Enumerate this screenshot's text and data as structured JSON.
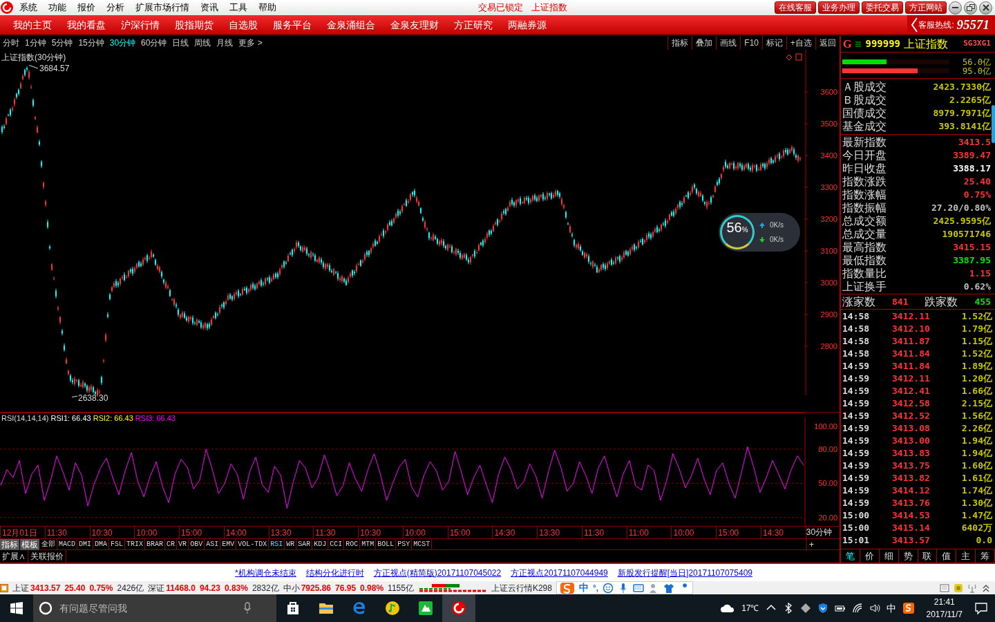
{
  "menu_bar": {
    "menus": [
      "系统",
      "功能",
      "报价",
      "分析",
      "扩展市场行情",
      "资讯",
      "工具",
      "帮助"
    ],
    "status": [
      "交易已锁定",
      "上证指数"
    ],
    "buttons": [
      "在线客服",
      "业务办理",
      "委托交易",
      "方正网站"
    ]
  },
  "nav": {
    "items": [
      "我的主页",
      "我的看盘",
      "沪深行情",
      "股指期货",
      "自选股",
      "服务平台",
      "金泉涌组合",
      "金泉友理财",
      "方正研究",
      "两融券源"
    ],
    "hotline_label": "客服热线:",
    "hotline": "95571"
  },
  "periods": [
    {
      "label": "分时",
      "selected": false
    },
    {
      "label": "1分钟",
      "selected": false
    },
    {
      "label": "5分钟",
      "selected": false
    },
    {
      "label": "15分钟",
      "selected": false
    },
    {
      "label": "30分钟",
      "selected": true
    },
    {
      "label": "60分钟",
      "selected": false
    },
    {
      "label": "日线",
      "selected": false
    },
    {
      "label": "周线",
      "selected": false
    },
    {
      "label": "月线",
      "selected": false
    },
    {
      "label": "更多 >",
      "selected": false
    }
  ],
  "chart_tools": [
    "指标",
    "叠加",
    "画线",
    "F10",
    "标记",
    "+自选",
    "返回"
  ],
  "price_chart": {
    "title": "上证指数(30分钟)",
    "high_label": "3684.57",
    "low_label": "2638.30",
    "axis_labels": [
      "3600",
      "3500",
      "3400",
      "3300",
      "3200",
      "3100",
      "3000",
      "2900",
      "2800"
    ]
  },
  "rsi": {
    "title": "RSI(14,14,14)",
    "lines": [
      {
        "label": "RSI1: 66.43",
        "color": "#ffffff"
      },
      {
        "label": "RSI2: 66.43",
        "color": "#ffff00"
      },
      {
        "label": "RSI3: 66.43",
        "color": "#ff00ff"
      }
    ],
    "chart_data": {
      "type": "line",
      "grid": true,
      "ylim": [
        12,
        112
      ],
      "yticks": [
        {
          "value": 100,
          "label": "100.00"
        },
        {
          "value": 80,
          "label": "80.00"
        },
        {
          "value": 50,
          "label": "50.00"
        },
        {
          "value": 20,
          "label": "20.00"
        }
      ],
      "series": [
        {
          "color": "#ff00ff",
          "values": [
            48,
            62,
            55,
            70,
            41,
            58,
            66,
            35,
            52,
            74,
            60,
            44,
            68,
            57,
            30,
            49,
            63,
            72,
            55,
            40,
            61,
            77,
            52,
            38,
            56,
            69,
            47,
            33,
            58,
            71,
            64,
            45,
            53,
            80,
            62,
            41,
            50,
            67,
            58,
            36,
            60,
            73,
            49,
            42,
            65,
            57,
            28,
            51,
            70,
            63,
            46,
            55,
            75,
            59,
            39,
            48,
            68,
            54,
            43,
            62,
            76,
            58,
            35,
            50,
            64,
            71,
            47,
            38,
            57,
            69,
            61,
            44,
            52,
            78,
            60,
            40,
            55,
            66,
            49,
            33,
            58,
            73,
            62,
            45,
            51,
            67,
            56,
            37,
            60,
            79,
            64,
            43,
            50,
            69,
            57,
            41,
            63,
            74,
            55,
            38,
            58,
            70,
            48,
            44,
            66,
            61,
            35,
            52,
            76,
            63,
            46,
            57,
            72,
            54,
            40,
            61,
            68,
            50,
            37,
            59,
            82,
            64,
            42,
            55,
            70,
            58,
            45,
            62,
            74,
            66
          ]
        }
      ]
    }
  },
  "time_axis": {
    "labels": [
      "12月01日",
      "11:30",
      "10:30",
      "10:00",
      "15:00",
      "14:00",
      "13:30",
      "11:30",
      "10:30",
      "10:00",
      "15:00",
      "14:30",
      "13:30",
      "11:30",
      "11:00",
      "10:00",
      "15:00",
      "14:30"
    ],
    "period": "30分钟",
    "plus": "+"
  },
  "indicator_menu": [
    "指标",
    "模板"
  ],
  "indicators": [
    {
      "label": "全部",
      "selected": false
    },
    {
      "label": "MACD",
      "selected": false
    },
    {
      "label": "DMI",
      "selected": false
    },
    {
      "label": "DMA",
      "selected": false
    },
    {
      "label": "FSL",
      "selected": false
    },
    {
      "label": "TRIX",
      "selected": false
    },
    {
      "label": "BRAR",
      "selected": false
    },
    {
      "label": "CR",
      "selected": false
    },
    {
      "label": "VR",
      "selected": false
    },
    {
      "label": "OBV",
      "selected": false
    },
    {
      "label": "ASI",
      "selected": false
    },
    {
      "label": "EMV",
      "selected": false
    },
    {
      "label": "VOL-TDX",
      "selected": false
    },
    {
      "label": "RSI",
      "selected": true
    },
    {
      "label": "WR",
      "selected": false
    },
    {
      "label": "SAR",
      "selected": false
    },
    {
      "label": "KDJ",
      "selected": false
    },
    {
      "label": "CCI",
      "selected": false
    },
    {
      "label": "ROC",
      "selected": false
    },
    {
      "label": "MTM",
      "selected": false
    },
    {
      "label": "BOLL",
      "selected": false
    },
    {
      "label": "PSY",
      "selected": false
    },
    {
      "label": "MCST",
      "selected": false
    }
  ],
  "ext_tabs": [
    "扩展∧",
    "关联报价"
  ],
  "quote": {
    "prefix": "G",
    "code": "999999",
    "name": "上证指数",
    "tag": "SG3XG1"
  },
  "flow_bars": [
    {
      "reading": "56.0亿",
      "level": 0.41,
      "color": "#00dd00"
    },
    {
      "reading": "95.0亿",
      "level": 0.7,
      "color": "#ff3333"
    }
  ],
  "turnover": [
    {
      "label": "Ａ股成交",
      "value": "2423.7330亿"
    },
    {
      "label": "Ｂ股成交",
      "value": "2.2265亿"
    },
    {
      "label": "国债成交",
      "value": "8979.7971亿"
    },
    {
      "label": "基金成交",
      "value": "393.8141亿"
    }
  ],
  "stats": [
    {
      "label": "最新指数",
      "value": "3413.5",
      "color": "#ff3232"
    },
    {
      "label": "今日开盘",
      "value": "3389.47",
      "color": "#ff3232"
    },
    {
      "label": "昨日收盘",
      "value": "3388.17",
      "color": "#ffffff"
    },
    {
      "label": "指数涨跌",
      "value": "25.40",
      "color": "#ff3232"
    },
    {
      "label": "指数涨幅",
      "value": "0.75%",
      "color": "#ff3232"
    },
    {
      "label": "指数振幅",
      "value": "27.20/0.80%",
      "color": "#c0c0c0"
    },
    {
      "label": "总成交额",
      "value": "2425.9595亿",
      "color": "#c8c800"
    },
    {
      "label": "总成交量",
      "value": "190571746",
      "color": "#c8c800"
    },
    {
      "label": "最高指数",
      "value": "3415.15",
      "color": "#ff3232"
    },
    {
      "label": "最低指数",
      "value": "3387.95",
      "color": "#00e600"
    },
    {
      "label": "指数量比",
      "value": "1.15",
      "color": "#ff3232"
    },
    {
      "label": "上证换手",
      "value": "0.62%",
      "color": "#c0c0c0"
    }
  ],
  "breadth": {
    "up_label": "涨家数",
    "up": "841",
    "down_label": "跌家数",
    "down": "455"
  },
  "ticks": [
    {
      "time": "14:58",
      "price": "3412.11",
      "volume": "1.52亿"
    },
    {
      "time": "14:58",
      "price": "3412.10",
      "volume": "1.79亿"
    },
    {
      "time": "14:58",
      "price": "3411.87",
      "volume": "1.15亿"
    },
    {
      "time": "14:58",
      "price": "3411.84",
      "volume": "1.52亿"
    },
    {
      "time": "14:59",
      "price": "3411.84",
      "volume": "1.89亿"
    },
    {
      "time": "14:59",
      "price": "3412.11",
      "volume": "1.20亿"
    },
    {
      "time": "14:59",
      "price": "3412.41",
      "volume": "1.66亿"
    },
    {
      "time": "14:59",
      "price": "3412.58",
      "volume": "2.15亿"
    },
    {
      "time": "14:59",
      "price": "3412.52",
      "volume": "1.56亿"
    },
    {
      "time": "14:59",
      "price": "3413.08",
      "volume": "2.26亿"
    },
    {
      "time": "14:59",
      "price": "3413.00",
      "volume": "1.94亿"
    },
    {
      "time": "14:59",
      "price": "3413.83",
      "volume": "1.94亿"
    },
    {
      "time": "14:59",
      "price": "3413.75",
      "volume": "1.60亿"
    },
    {
      "time": "14:59",
      "price": "3413.82",
      "volume": "1.61亿"
    },
    {
      "time": "14:59",
      "price": "3414.12",
      "volume": "1.74亿"
    },
    {
      "time": "14:59",
      "price": "3413.76",
      "volume": "1.30亿"
    },
    {
      "time": "15:00",
      "price": "3414.53",
      "volume": "1.47亿"
    },
    {
      "time": "15:00",
      "price": "3415.14",
      "volume": "6402万"
    },
    {
      "time": "15:01",
      "price": "3413.57",
      "volume": "0.0"
    }
  ],
  "panel_tabs": [
    {
      "label": "笔",
      "selected": true
    },
    {
      "label": "价",
      "selected": false
    },
    {
      "label": "细",
      "selected": false
    },
    {
      "label": "势",
      "selected": false
    },
    {
      "label": "联",
      "selected": false
    },
    {
      "label": "值",
      "selected": false
    },
    {
      "label": "主",
      "selected": false
    },
    {
      "label": "筹",
      "selected": false
    }
  ],
  "net_widget": {
    "percent": "56",
    "percent_sign": "%",
    "up": "0K/s",
    "down": "0K/s"
  },
  "news": [
    "*机构调仓未结束",
    "结构分化进行时",
    "方正视点(精简版)20171107045022",
    "方正视点20171107044949",
    "新股发行提醒[当日]20171107075409"
  ],
  "index_bar": [
    {
      "name": "上证",
      "price": "3413.57",
      "change": "25.40",
      "pct": "0.75%",
      "amount": "2426亿"
    },
    {
      "name": "深证",
      "price": "11468.0",
      "change": "94.23",
      "pct": "0.83%",
      "amount": "2832亿"
    },
    {
      "name": "中小",
      "price": "7925.86",
      "change": "76.95",
      "pct": "0.98%",
      "amount": "1155亿"
    }
  ],
  "cloud_quote": "上证云行情K298",
  "ime": {
    "mode": "中",
    "punct": "°,"
  },
  "taskbar": {
    "search_placeholder": "有问题尽管问我",
    "weather": "17℃",
    "ime": "中",
    "time": "21:41",
    "date": "2017/11/7"
  }
}
